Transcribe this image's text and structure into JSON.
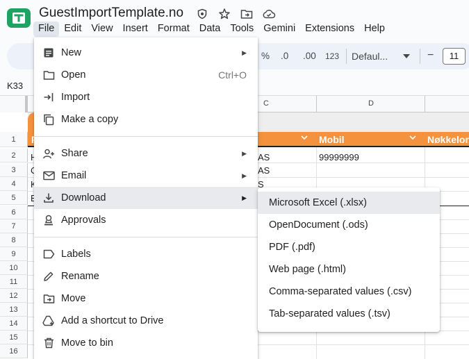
{
  "doc": {
    "title": "GuestImportTemplate.no"
  },
  "menubar": [
    "File",
    "Edit",
    "View",
    "Insert",
    "Format",
    "Data",
    "Tools",
    "Gemini",
    "Extensions",
    "Help"
  ],
  "toolbar": {
    "percent": "%",
    "dec_decrease": ".0",
    "dec_increase": ".00",
    "number_format": "123",
    "font": "Defaul...",
    "minus": "−",
    "font_size": "11"
  },
  "namebox": "K33",
  "columns": [
    "C",
    "D"
  ],
  "rows": [
    "1",
    "2",
    "3",
    "4",
    "5",
    "6",
    "7",
    "8",
    "9",
    "10",
    "11",
    "12",
    "13",
    "14",
    "15",
    "16"
  ],
  "sheet": {
    "header_a": "F",
    "header_c": "",
    "header_d": "Mobil",
    "header_e": "Nøkkelord",
    "r2_a": "H",
    "r2_c": "AS",
    "r2_d": "99999999",
    "r3_a": "C",
    "r3_c": "AS",
    "r4_a": "K",
    "r4_c": "S",
    "r5_a": "E"
  },
  "file_menu": {
    "items": [
      {
        "label": "New",
        "icon": "new-sheet-icon",
        "submenu": true
      },
      {
        "label": "Open",
        "icon": "folder-icon",
        "shortcut": "Ctrl+O"
      },
      {
        "label": "Import",
        "icon": "import-icon"
      },
      {
        "label": "Make a copy",
        "icon": "copy-icon"
      },
      {
        "label": "Share",
        "icon": "share-icon",
        "submenu": true
      },
      {
        "label": "Email",
        "icon": "email-icon",
        "submenu": true
      },
      {
        "label": "Download",
        "icon": "download-icon",
        "submenu": true
      },
      {
        "label": "Approvals",
        "icon": "approvals-icon"
      },
      {
        "label": "Labels",
        "icon": "label-icon"
      },
      {
        "label": "Rename",
        "icon": "pencil-icon"
      },
      {
        "label": "Move",
        "icon": "move-folder-icon"
      },
      {
        "label": "Add a shortcut to Drive",
        "icon": "drive-shortcut-icon"
      },
      {
        "label": "Move to bin",
        "icon": "trash-icon"
      }
    ]
  },
  "download_menu": {
    "items": [
      "Microsoft Excel (.xlsx)",
      "OpenDocument (.ods)",
      "PDF (.pdf)",
      "Web page (.html)",
      "Comma-separated values (.csv)",
      "Tab-separated values (.tsv)"
    ]
  },
  "colors": {
    "accent_orange": "#f5923e",
    "menu_hover": "#e8eaed",
    "logo_green": "#1ea362"
  }
}
